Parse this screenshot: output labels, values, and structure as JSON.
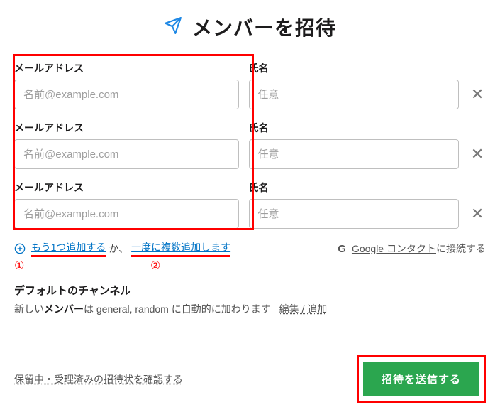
{
  "title": "メンバーを招待",
  "rows": [
    {
      "email_label": "メールアドレス",
      "email_placeholder": "名前@example.com",
      "name_label": "氏名",
      "name_placeholder": "任意"
    },
    {
      "email_label": "メールアドレス",
      "email_placeholder": "名前@example.com",
      "name_label": "氏名",
      "name_placeholder": "任意"
    },
    {
      "email_label": "メールアドレス",
      "email_placeholder": "名前@example.com",
      "name_label": "氏名",
      "name_placeholder": "任意"
    }
  ],
  "links": {
    "add_one": "もう1つ追加する",
    "or_text": "か、",
    "add_many": "一度に複数追加します",
    "google_prefix": "Google コンタクト",
    "google_suffix": "に接続する"
  },
  "annotations": {
    "num1": "①",
    "num2": "②"
  },
  "default_channel": {
    "title": "デフォルトのチャンネル",
    "prefix": "新しい",
    "bold": "メンバー",
    "suffix": "は general, random に自動的に加わります",
    "edit": "編集 / 追加"
  },
  "footer": {
    "pending": "保留中・受理済みの招待状を確認する",
    "send": "招待を送信する"
  }
}
